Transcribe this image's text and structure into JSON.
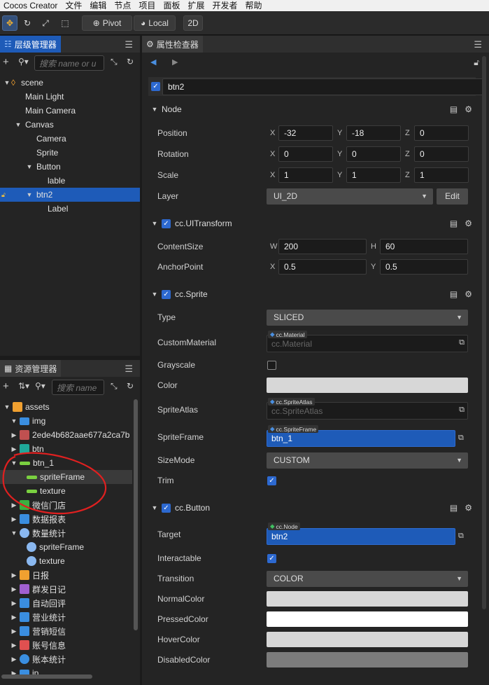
{
  "menu": [
    "Cocos Creator",
    "文件",
    "编辑",
    "节点",
    "项目",
    "面板",
    "扩展",
    "开发者",
    "帮助"
  ],
  "toolbar": {
    "pivot": "Pivot",
    "local": "Local",
    "mode2d": "2D"
  },
  "hierarchy": {
    "title": "层级管理器",
    "search_placeholder": "搜索 name or u",
    "nodes": [
      {
        "label": "scene",
        "depth": 0,
        "arrow": "▼"
      },
      {
        "label": "Main Light",
        "depth": 1,
        "arrow": ""
      },
      {
        "label": "Main Camera",
        "depth": 1,
        "arrow": ""
      },
      {
        "label": "Canvas",
        "depth": 1,
        "arrow": "▼"
      },
      {
        "label": "Camera",
        "depth": 2,
        "arrow": ""
      },
      {
        "label": "Sprite",
        "depth": 2,
        "arrow": ""
      },
      {
        "label": "Button",
        "depth": 2,
        "arrow": "▼"
      },
      {
        "label": "lable",
        "depth": 3,
        "arrow": ""
      },
      {
        "label": "btn2",
        "depth": 2,
        "arrow": "▼"
      },
      {
        "label": "Label",
        "depth": 3,
        "arrow": ""
      }
    ]
  },
  "assets": {
    "title": "资源管理器",
    "search_placeholder": "搜索 name",
    "items": [
      {
        "label": "assets",
        "depth": 0,
        "arrow": "▼",
        "icon": "database-icon",
        "color": "#f0a030"
      },
      {
        "label": "img",
        "depth": 1,
        "arrow": "▼",
        "icon": "folder-icon",
        "color": "#3a8ee0"
      },
      {
        "label": "2ede4b682aae677a2ca7b",
        "depth": 1,
        "arrow": "▶",
        "icon": "image-icon",
        "color": "#c05050"
      },
      {
        "label": "btn",
        "depth": 1,
        "arrow": "▶",
        "icon": "teal-image-icon",
        "color": "#1fa89a"
      },
      {
        "label": "btn_1",
        "depth": 1,
        "arrow": "▼",
        "icon": "green-bar-icon",
        "color": "#7ad040"
      },
      {
        "label": "spriteFrame",
        "depth": 2,
        "arrow": "",
        "icon": "green-bar-icon",
        "color": "#7ad040"
      },
      {
        "label": "texture",
        "depth": 2,
        "arrow": "",
        "icon": "green-bar-icon",
        "color": "#7ad040"
      },
      {
        "label": "微信门店",
        "depth": 1,
        "arrow": "▶",
        "icon": "store-icon",
        "color": "#3cb040"
      },
      {
        "label": "数据报表",
        "depth": 1,
        "arrow": "▶",
        "icon": "chart-icon",
        "color": "#3a8ee0"
      },
      {
        "label": "数量统计",
        "depth": 1,
        "arrow": "▼",
        "icon": "pie-icon",
        "color": "#8ab8f0"
      },
      {
        "label": "spriteFrame",
        "depth": 2,
        "arrow": "",
        "icon": "pie-icon",
        "color": "#8ab8f0"
      },
      {
        "label": "texture",
        "depth": 2,
        "arrow": "",
        "icon": "pie-icon",
        "color": "#8ab8f0"
      },
      {
        "label": "日报",
        "depth": 1,
        "arrow": "▶",
        "icon": "calendar-icon",
        "color": "#f0a030"
      },
      {
        "label": "群发日记",
        "depth": 1,
        "arrow": "▶",
        "icon": "notebook-icon",
        "color": "#a060d0"
      },
      {
        "label": "自动回评",
        "depth": 1,
        "arrow": "▶",
        "icon": "chat-icon",
        "color": "#3a8ee0"
      },
      {
        "label": "营业统计",
        "depth": 1,
        "arrow": "▶",
        "icon": "dollar-icon",
        "color": "#3a8ee0"
      },
      {
        "label": "营销短信",
        "depth": 1,
        "arrow": "▶",
        "icon": "star-badge-icon",
        "color": "#3a8ee0"
      },
      {
        "label": "账号信息",
        "depth": 1,
        "arrow": "▶",
        "icon": "user-icon",
        "color": "#e05050"
      },
      {
        "label": "账本统计",
        "depth": 1,
        "arrow": "▶",
        "icon": "pie-icon",
        "color": "#3a8ee0"
      },
      {
        "label": "ip",
        "depth": 1,
        "arrow": "▶",
        "icon": "folder-icon",
        "color": "#3a8ee0"
      }
    ]
  },
  "inspector": {
    "title": "属性检查器",
    "node_name": "btn2",
    "node_section": "Node",
    "position": {
      "label": "Position",
      "x": "-32",
      "y": "-18",
      "z": "0"
    },
    "rotation": {
      "label": "Rotation",
      "x": "0",
      "y": "0",
      "z": "0"
    },
    "scale": {
      "label": "Scale",
      "x": "1",
      "y": "1",
      "z": "1"
    },
    "layer": {
      "label": "Layer",
      "value": "UI_2D",
      "edit": "Edit"
    },
    "uitransform": {
      "title": "cc.UITransform",
      "content_label": "ContentSize",
      "w": "200",
      "h": "60",
      "anchor_label": "AnchorPoint",
      "ax": "0.5",
      "ay": "0.5"
    },
    "sprite": {
      "title": "cc.Sprite",
      "type_label": "Type",
      "type_value": "SLICED",
      "material_label": "CustomMaterial",
      "material_tag": "cc.Material",
      "material_value": "cc.Material",
      "grayscale_label": "Grayscale",
      "color_label": "Color",
      "atlas_label": "SpriteAtlas",
      "atlas_tag": "cc.SpriteAtlas",
      "atlas_value": "cc.SpriteAtlas",
      "frame_label": "SpriteFrame",
      "frame_tag": "cc.SpriteFrame",
      "frame_value": "btn_1",
      "sizemode_label": "SizeMode",
      "sizemode_value": "CUSTOM",
      "trim_label": "Trim"
    },
    "button": {
      "title": "cc.Button",
      "target_label": "Target",
      "target_tag": "cc.Node",
      "target_value": "btn2",
      "interactable_label": "Interactable",
      "transition_label": "Transition",
      "transition_value": "COLOR",
      "normal_label": "NormalColor",
      "pressed_label": "PressedColor",
      "hover_label": "HoverColor",
      "disabled_label": "DisabledColor"
    },
    "axis": {
      "x": "X",
      "y": "Y",
      "z": "Z",
      "w": "W",
      "h": "H"
    }
  },
  "colors": {
    "accent": "#1e5bb8",
    "annotation": "#e02020",
    "normal": "#d7d7d7",
    "pressed": "#ffffff",
    "hover": "#d7d7d7",
    "disabled": "#7c7c7c"
  }
}
